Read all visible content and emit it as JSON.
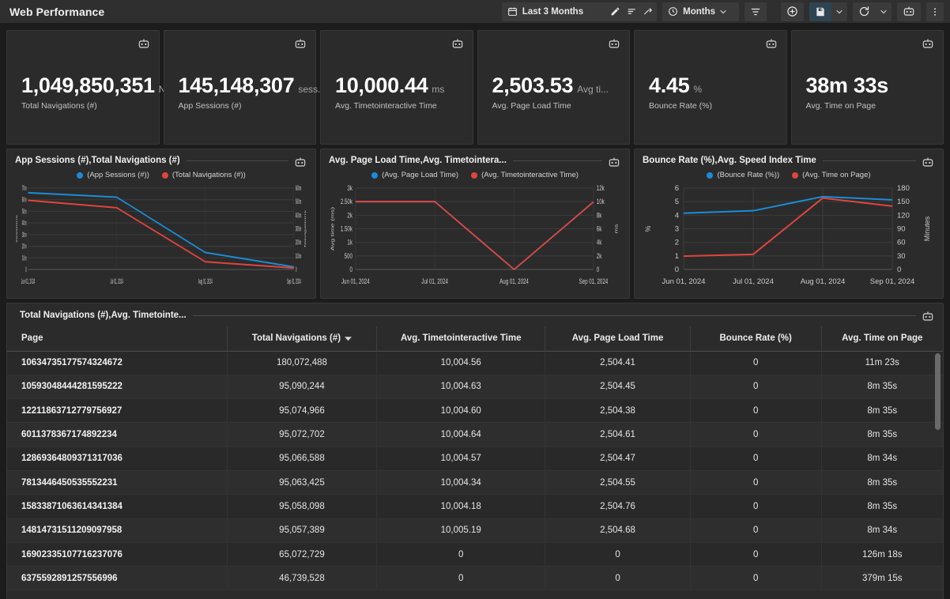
{
  "header": {
    "title": "Web Performance",
    "date_range": "Last 3 Months",
    "granularity": "Months",
    "icons": {
      "calendar": "calendar-icon",
      "edit": "pencil-icon",
      "sort": "sort-icon",
      "compare": "compare-icon",
      "clock": "clock-icon",
      "chevron": "chevron-down-icon",
      "filter": "filter-icon",
      "add": "plus-circle-icon",
      "save": "save-icon",
      "refresh": "refresh-icon",
      "assistant": "assistant-icon",
      "more": "kebab-menu-icon"
    }
  },
  "kpis": [
    {
      "value": "1,049,850,351",
      "unit": "Navi...",
      "label": "Total Navigations (#)"
    },
    {
      "value": "145,148,307",
      "unit": "sess...",
      "label": "App Sessions (#)"
    },
    {
      "value": "10,000.44",
      "unit": "ms",
      "label": "Avg. Timetointeractive Time"
    },
    {
      "value": "2,503.53",
      "unit": "Avg ti...",
      "label": "Avg. Page Load Time"
    },
    {
      "value": "4.45",
      "unit": "%",
      "label": "Bounce Rate (%)"
    },
    {
      "value": "38m 33s",
      "unit": "",
      "label": "Avg. Time on Page"
    }
  ],
  "colors": {
    "series_blue": "#1a8cd8",
    "series_red": "#e0453f",
    "panel": "#2b2b2b",
    "page": "#1c1c1c",
    "accent": "#2e4452"
  },
  "chart_data": [
    {
      "type": "line",
      "title": "App Sessions (#),Total Navigations (#)",
      "xlabel": "",
      "ylabel": "sessions",
      "y2label": "Navigations",
      "categories": [
        "Jun 01, 2024",
        "Jul 01, 2024",
        "Aug 01, 2024",
        "Sep 01, 2024"
      ],
      "yticks": [
        "0",
        "10m",
        "20m",
        "30m",
        "40m",
        "50m",
        "60m",
        "70m"
      ],
      "y2ticks": [
        "0",
        "100m",
        "200m",
        "300m",
        "400m",
        "500m",
        "600m"
      ],
      "ylim": [
        0,
        70
      ],
      "y2lim": [
        0,
        600
      ],
      "grid": true,
      "legend_position": "top",
      "series": [
        {
          "name": "(App Sessions (#))",
          "color": "#1a8cd8",
          "axis": "left",
          "values": [
            66.0,
            62.2,
            14.6,
            2.2
          ]
        },
        {
          "name": "(Total Navigations (#))",
          "color": "#e0453f",
          "axis": "right",
          "values": [
            510,
            455,
            57,
            11
          ]
        }
      ]
    },
    {
      "type": "line",
      "title": "Avg. Page Load Time,Avg. Timetointera...",
      "xlabel": "",
      "ylabel": "Avg time (ms)",
      "y2label": "ms",
      "categories": [
        "Jun 01, 2024",
        "Jul 01, 2024",
        "Aug 01, 2024",
        "Sep 01, 2024"
      ],
      "yticks": [
        "0",
        "500",
        "1k",
        "1.50k",
        "2k",
        "2.50k",
        "3k"
      ],
      "y2ticks": [
        "0",
        "2k",
        "4k",
        "6k",
        "8k",
        "10k",
        "12k"
      ],
      "ylim": [
        0,
        3000
      ],
      "y2lim": [
        0,
        12000
      ],
      "grid": true,
      "legend_position": "top",
      "series": [
        {
          "name": "(Avg. Page Load Time)",
          "color": "#1a8cd8",
          "axis": "left",
          "values": [
            2500,
            2500,
            0,
            2490
          ]
        },
        {
          "name": "(Avg. Timetointeractive Time)",
          "color": "#e0453f",
          "axis": "right",
          "values": [
            10000,
            10000,
            0,
            9960
          ]
        }
      ]
    },
    {
      "type": "line",
      "title": "Bounce Rate (%),Avg. Speed Index Time",
      "xlabel": "",
      "ylabel": "%",
      "y2label": "Minutes",
      "categories": [
        "Jun 01, 2024",
        "Jul 01, 2024",
        "Aug 01, 2024",
        "Sep 01, 2024"
      ],
      "yticks": [
        "0",
        "1",
        "2",
        "3",
        "4",
        "5",
        "6"
      ],
      "y2ticks": [
        "0",
        "30",
        "60",
        "90",
        "120",
        "150",
        "180"
      ],
      "ylim": [
        0,
        6
      ],
      "y2lim": [
        0,
        180
      ],
      "grid": true,
      "legend_position": "top",
      "series": [
        {
          "name": "(Bounce Rate (%))",
          "color": "#1a8cd8",
          "axis": "left",
          "values": [
            4.15,
            4.33,
            5.37,
            5.13
          ]
        },
        {
          "name": "(Avg. Time on Page)",
          "color": "#e0453f",
          "axis": "right",
          "values": [
            29.5,
            33.5,
            158,
            140
          ]
        }
      ]
    }
  ],
  "table": {
    "title": "Total Navigations (#),Avg. Timetointe...",
    "sorted_column": "Total Navigations (#)",
    "sort_direction": "desc",
    "columns": [
      "Page",
      "Total Navigations (#)",
      "Avg. Timetointeractive Time",
      "Avg. Page Load Time",
      "Bounce Rate (%)",
      "Avg. Time on Page"
    ],
    "rows": [
      [
        "10634735177574324672",
        "180,072,488",
        "10,004.56",
        "2,504.41",
        "0",
        "11m 23s"
      ],
      [
        "10593048444281595222",
        "95,090,244",
        "10,004.63",
        "2,504.45",
        "0",
        "8m 35s"
      ],
      [
        "12211863712779756927",
        "95,074,966",
        "10,004.60",
        "2,504.38",
        "0",
        "8m 35s"
      ],
      [
        "6011378367174892234",
        "95,072,702",
        "10,004.64",
        "2,504.61",
        "0",
        "8m 35s"
      ],
      [
        "12869364809371317036",
        "95,066,588",
        "10,004.57",
        "2,504.47",
        "0",
        "8m 34s"
      ],
      [
        "7813446450535552231",
        "95,063,425",
        "10,004.34",
        "2,504.55",
        "0",
        "8m 35s"
      ],
      [
        "15833871063614341384",
        "95,058,098",
        "10,004.18",
        "2,504.76",
        "0",
        "8m 35s"
      ],
      [
        "14814731511209097958",
        "95,057,389",
        "10,005.19",
        "2,504.68",
        "0",
        "8m 34s"
      ],
      [
        "16902335107716237076",
        "65,072,729",
        "0",
        "0",
        "0",
        "126m 18s"
      ],
      [
        "6375592891257556996",
        "46,739,528",
        "0",
        "0",
        "0",
        "379m 15s"
      ]
    ]
  }
}
